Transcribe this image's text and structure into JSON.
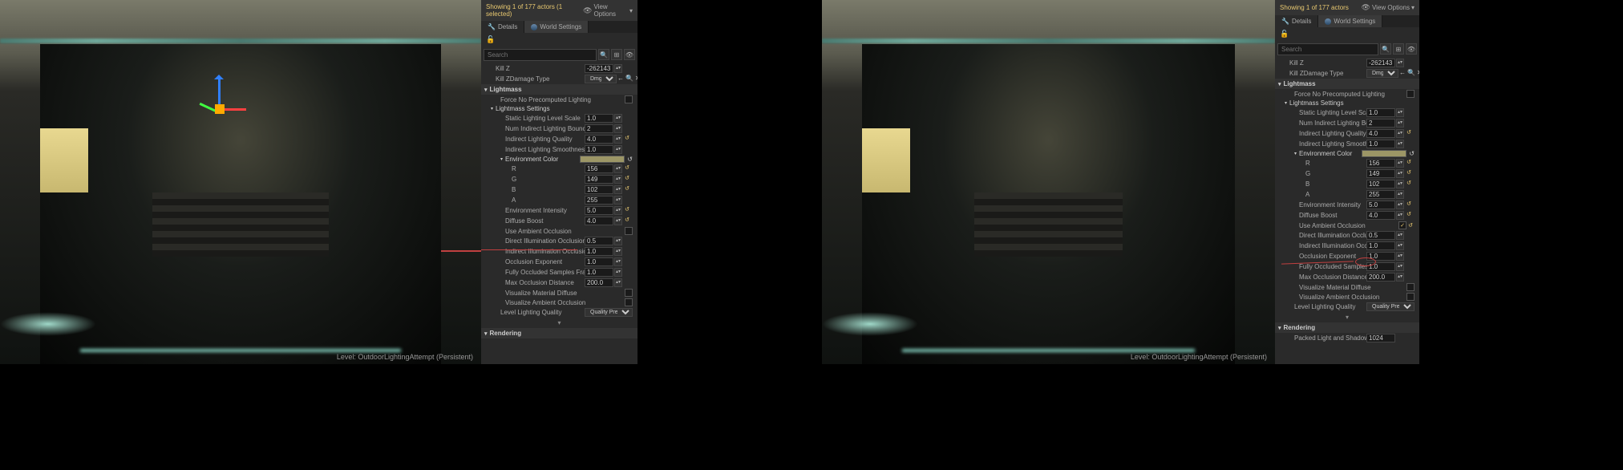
{
  "left": {
    "actor_text": "Showing 1 of 177 actors (1 selected)",
    "view_options": "View Options",
    "tabs": {
      "details": "Details",
      "world": "World Settings"
    },
    "search_placeholder": "Search",
    "killz": {
      "label": "Kill Z",
      "value": "-262143.0"
    },
    "killz_type": {
      "label": "Kill ZDamage Type",
      "value": "Dmg"
    },
    "lightmass_hdr": "Lightmass",
    "force_no": {
      "label": "Force No Precomputed Lighting"
    },
    "lightmass_settings": "Lightmass Settings",
    "static_scale": {
      "label": "Static Lighting Level Scale",
      "value": "1.0"
    },
    "bounces": {
      "label": "Num Indirect Lighting Bounces",
      "value": "2"
    },
    "quality": {
      "label": "Indirect Lighting Quality",
      "value": "4.0"
    },
    "smooth": {
      "label": "Indirect Lighting Smoothness",
      "value": "1.0"
    },
    "env_color": "Environment Color",
    "r": {
      "label": "R",
      "value": "156"
    },
    "g": {
      "label": "G",
      "value": "149"
    },
    "b": {
      "label": "B",
      "value": "102"
    },
    "a": {
      "label": "A",
      "value": "255"
    },
    "env_int": {
      "label": "Environment Intensity",
      "value": "5.0"
    },
    "diffuse": {
      "label": "Diffuse Boost",
      "value": "4.0"
    },
    "use_ao": {
      "label": "Use Ambient Occlusion"
    },
    "dir_ao": {
      "label": "Direct Illumination Occlusion Frac",
      "value": "0.5"
    },
    "ind_ao": {
      "label": "Indirect Illumination Occlusion Fr",
      "value": "1.0"
    },
    "occ_exp": {
      "label": "Occlusion Exponent",
      "value": "1.0"
    },
    "fully_occ": {
      "label": "Fully Occluded Samples Fraction",
      "value": "1.0"
    },
    "max_occ": {
      "label": "Max Occlusion Distance",
      "value": "200.0"
    },
    "viz_mat": {
      "label": "Visualize Material Diffuse"
    },
    "viz_ao": {
      "label": "Visualize Ambient Occlusion"
    },
    "level_q": {
      "label": "Level Lighting Quality",
      "value": "Quality Preview"
    },
    "rendering_hdr": "Rendering",
    "status": "Level:   OutdoorLightingAttempt (Persistent)"
  },
  "right": {
    "actor_text": "Showing 1 of 177 actors",
    "view_options": "View Options",
    "tabs": {
      "details": "Details",
      "world": "World Settings"
    },
    "search_placeholder": "Search",
    "killz": {
      "label": "Kill Z",
      "value": "-262143.0"
    },
    "killz_type": {
      "label": "Kill ZDamage Type",
      "value": "Dmg"
    },
    "lightmass_hdr": "Lightmass",
    "force_no": {
      "label": "Force No Precomputed Lighting"
    },
    "lightmass_settings": "Lightmass Settings",
    "static_scale": {
      "label": "Static Lighting Level Scale",
      "value": "1.0"
    },
    "bounces": {
      "label": "Num Indirect Lighting Bounces",
      "value": "2"
    },
    "quality": {
      "label": "Indirect Lighting Quality",
      "value": "4.0"
    },
    "smooth": {
      "label": "Indirect Lighting Smoothness",
      "value": "1.0"
    },
    "env_color": "Environment Color",
    "r": {
      "label": "R",
      "value": "156"
    },
    "g": {
      "label": "G",
      "value": "149"
    },
    "b": {
      "label": "B",
      "value": "102"
    },
    "a": {
      "label": "A",
      "value": "255"
    },
    "env_int": {
      "label": "Environment Intensity",
      "value": "5.0"
    },
    "diffuse": {
      "label": "Diffuse Boost",
      "value": "4.0"
    },
    "use_ao": {
      "label": "Use Ambient Occlusion",
      "checked": true
    },
    "dir_ao": {
      "label": "Direct Illumination Occlusion Frac",
      "value": "0.5"
    },
    "ind_ao": {
      "label": "Indirect Illumination Occlusion Fr",
      "value": "1.0"
    },
    "occ_exp": {
      "label": "Occlusion Exponent",
      "value": "1.0"
    },
    "fully_occ": {
      "label": "Fully Occluded Samples Fraction",
      "value": "1.0"
    },
    "max_occ": {
      "label": "Max Occlusion Distance",
      "value": "200.0"
    },
    "viz_mat": {
      "label": "Visualize Material Diffuse"
    },
    "viz_ao": {
      "label": "Visualize Ambient Occlusion"
    },
    "level_q": {
      "label": "Level Lighting Quality",
      "value": "Quality Preview"
    },
    "rendering_hdr": "Rendering",
    "packed": {
      "label": "Packed Light and Shadow Map Text",
      "value": "1024"
    },
    "status": "Level:   OutdoorLightingAttempt (Persistent)"
  }
}
